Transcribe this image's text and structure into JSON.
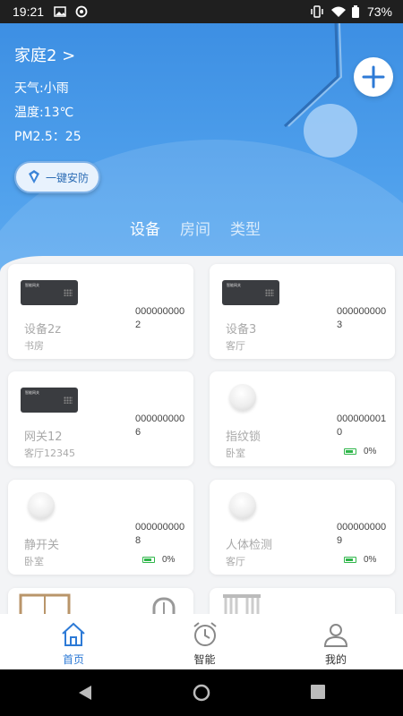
{
  "status_bar": {
    "time": "19:21",
    "battery": "73%"
  },
  "header": {
    "home_name": "家庭2 >",
    "weather": "天气:小雨",
    "temperature": "温度:13℃",
    "pm25": "PM2.5：25"
  },
  "security_button": {
    "label": "一键安防"
  },
  "tabs": [
    {
      "label": "设备"
    },
    {
      "label": "房间"
    },
    {
      "label": "类型"
    }
  ],
  "devices": [
    {
      "name": "设备2z",
      "room": "书房",
      "serial": "0000000002",
      "image": "gateway"
    },
    {
      "name": "设备3",
      "room": "客厅",
      "serial": "0000000003",
      "image": "gateway"
    },
    {
      "name": "网关12",
      "room": "客厅12345",
      "serial": "0000000006",
      "image": "gateway"
    },
    {
      "name": "指纹锁",
      "room": "卧室",
      "serial": "0000000010",
      "battery": "0%",
      "image": "button"
    },
    {
      "name": "静开关",
      "room": "卧室",
      "serial": "0000000008",
      "battery": "0%",
      "image": "button"
    },
    {
      "name": "人体检测",
      "room": "客厅",
      "serial": "0000000009",
      "battery": "0%",
      "image": "button"
    }
  ],
  "bottom_nav": [
    {
      "label": "首页",
      "icon": "home-icon"
    },
    {
      "label": "智能",
      "icon": "alarm-clock-icon"
    },
    {
      "label": "我的",
      "icon": "user-icon"
    }
  ],
  "colors": {
    "accent": "#2d7ad6",
    "hero_top": "#3d8fe3",
    "hero_bottom": "#62aef1",
    "battery_green": "#2fb64a"
  }
}
